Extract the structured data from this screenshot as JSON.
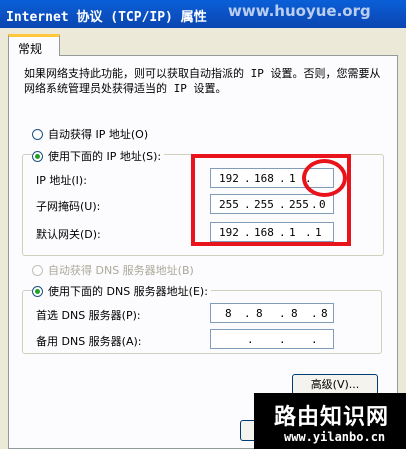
{
  "window": {
    "title": "Internet 协议 (TCP/IP) 属性",
    "watermark": "www.huoyue.org"
  },
  "tabs": [
    {
      "label": "常规"
    }
  ],
  "description": "如果网络支持此功能，则可以获取自动指派的 IP 设置。否则，您需要从网络系统管理员处获得适当的 IP 设置。",
  "ip": {
    "auto_label": "自动获得 IP 地址(O)",
    "manual_label": "使用下面的 IP 地址(S):",
    "fields": [
      {
        "label": "IP 地址(I):",
        "octets": [
          "192",
          "168",
          "1",
          ""
        ]
      },
      {
        "label": "子网掩码(U):",
        "octets": [
          "255",
          "255",
          "255",
          "0"
        ]
      },
      {
        "label": "默认网关(D):",
        "octets": [
          "192",
          "168",
          "1",
          "1"
        ]
      }
    ]
  },
  "dns": {
    "auto_label": "自动获得 DNS 服务器地址(B)",
    "manual_label": "使用下面的 DNS 服务器地址(E):",
    "fields": [
      {
        "label": "首选 DNS 服务器(P):",
        "octets": [
          "8",
          "8",
          "8",
          "8"
        ]
      },
      {
        "label": "备用 DNS 服务器(A):",
        "octets": [
          "",
          "",
          "",
          ""
        ]
      }
    ]
  },
  "buttons": {
    "advanced": "高级(V)..."
  },
  "logo": {
    "main": "路由知识网",
    "sub": "www.yilanbo.cn"
  },
  "colors": {
    "annotation": "#e8131b",
    "titlebar": "#0b4fc0"
  }
}
